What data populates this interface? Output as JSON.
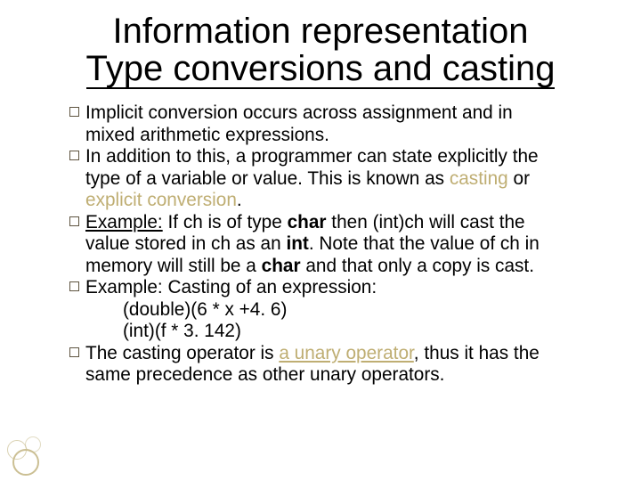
{
  "chart_data": null,
  "title": {
    "line1": "Information representation",
    "line2": "Type conversions and casting"
  },
  "bullets": {
    "b1a": "Implicit conversion occurs across assignment and in",
    "b1b": "mixed arithmetic expressions.",
    "b2a": "In addition to this, a programmer can state explicitly the",
    "b2b": "type of a variable or value. This is known as ",
    "b2c": "casting",
    "b2d": " or",
    "b2e": "explicit conversion",
    "b2f": ".",
    "b3a": "Example:",
    "b3b": " If ch is of type ",
    "b3c": "char",
    "b3d": " then ",
    "b3e": "(int)ch",
    "b3f": " will cast the",
    "b3g": "value stored in ch as an ",
    "b3h": "int",
    "b3i": ". Note that the value of ch in",
    "b3j": "memory will still be a ",
    "b3k": "char",
    "b3l": " and that only a copy is cast.",
    "b4a": "Example: Casting of an expression:",
    "b4b": "(double)(6 * x +4. 6)",
    "b4c": "(int)(f * 3. 142)",
    "b5a": "The casting operator is ",
    "b5b": "a unary operator",
    "b5c": ", thus it has the",
    "b5d": "same precedence as other unary operators."
  }
}
